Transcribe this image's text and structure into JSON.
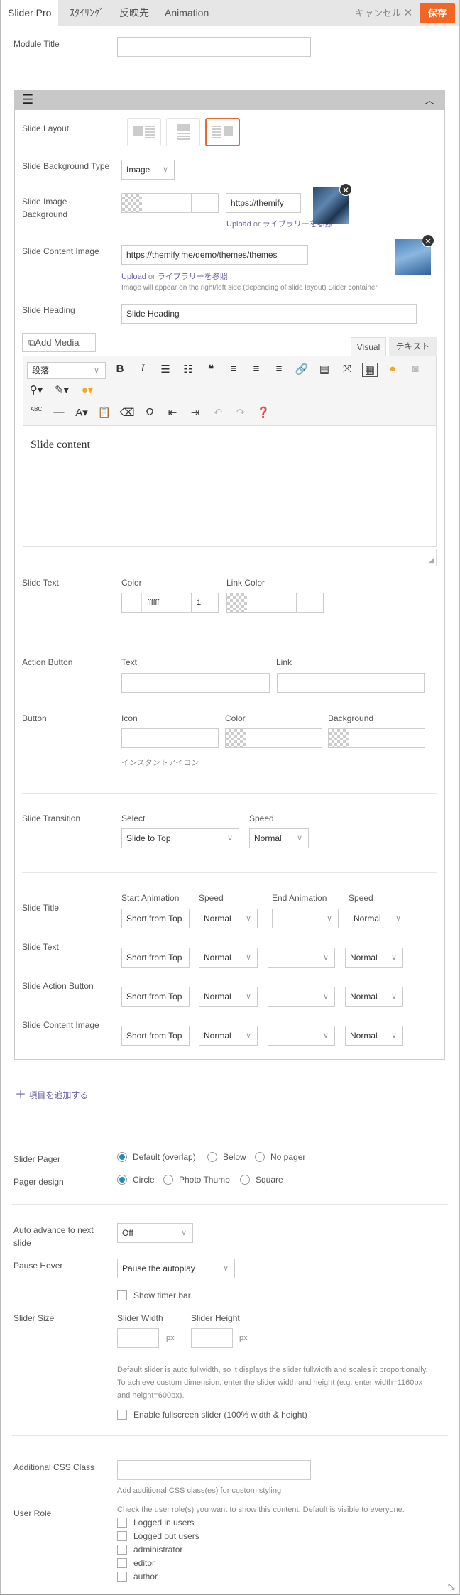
{
  "tabs": [
    "Slider Pro",
    "ｽﾀｲﾘﾝｸﾞ",
    "反映先",
    "Animation"
  ],
  "header": {
    "cancel": "キャンセル",
    "save": "保存"
  },
  "module_title": {
    "label": "Module Title",
    "value": ""
  },
  "slide": {
    "layout_label": "Slide Layout",
    "layout_selected": 3,
    "bg_type_label": "Slide Background Type",
    "bg_type": "Image",
    "bg_image_label": "Slide Image Background",
    "bg_image_url": "https://themify",
    "upload": "Upload",
    "or": "or",
    "library": "ライブラリーを参照",
    "content_image_label": "Slide Content Image",
    "content_image_url": "https://themify.me/demo/themes/themes",
    "content_image_help": "Image will appear on the right/left side (depending of slide layout) Slider container",
    "heading_label": "Slide Heading",
    "heading_value": "Slide Heading",
    "add_media": "Add Media",
    "tab_visual": "Visual",
    "tab_text": "テキスト",
    "format": "段落",
    "content": "Slide content",
    "text_label": "Slide Text",
    "color_label": "Color",
    "color_value": "ffffff",
    "opacity": "1",
    "link_color_label": "Link Color",
    "action_label": "Action Button",
    "text_field_label": "Text",
    "link_label": "Link",
    "button_label": "Button",
    "icon_label": "Icon",
    "bg_label": "Background",
    "instant_icon": "インスタントアイコン",
    "transition_label": "Slide Transition",
    "select_label": "Select",
    "transition": "Slide to Top",
    "speed_label": "Speed",
    "transition_speed": "Normal",
    "anim_headers": [
      "Start Animation",
      "Speed",
      "End Animation",
      "Speed"
    ],
    "anim_rows": [
      {
        "label": "Slide Title",
        "start": "Short from Top",
        "speed": "Normal",
        "end": "",
        "end_speed": "Normal"
      },
      {
        "label": "Slide Text",
        "start": "Short from Top",
        "speed": "Normal",
        "end": "",
        "end_speed": "Normal"
      },
      {
        "label": "Slide Action Button",
        "start": "Short from Top",
        "speed": "Normal",
        "end": "",
        "end_speed": "Normal"
      },
      {
        "label": "Slide Content Image",
        "start": "Short from Top",
        "speed": "Normal",
        "end": "",
        "end_speed": "Normal"
      }
    ]
  },
  "add_item": "項目を追加する",
  "pager": {
    "label": "Slider Pager",
    "options": [
      "Default (overlap)",
      "Below",
      "No pager"
    ],
    "selected": 0
  },
  "pager_design": {
    "label": "Pager design",
    "options": [
      "Circle",
      "Photo Thumb",
      "Square"
    ],
    "selected": 0
  },
  "auto": {
    "label": "Auto advance to next slide",
    "value": "Off"
  },
  "pause": {
    "label": "Pause Hover",
    "value": "Pause the autoplay",
    "timer": "Show timer bar"
  },
  "size": {
    "label": "Slider Size",
    "width_label": "Slider Width",
    "height_label": "Slider Height",
    "unit": "px",
    "help": "Default slider is auto fullwidth, so it displays the slider fullwidth and scales it proportionally. To achieve custom dimension, enter the slider width and height (e.g. enter width=1160px and height=600px).",
    "fullscreen": "Enable fullscreen slider (100% width & height)"
  },
  "css": {
    "label": "Additional CSS Class",
    "help": "Add additional CSS class(es) for custom styling"
  },
  "roles": {
    "label": "User Role",
    "help": "Check the user role(s) you want to show this content. Default is visible to everyone.",
    "options": [
      "Logged in users",
      "Logged out users",
      "administrator",
      "editor",
      "author"
    ]
  },
  "colors": {
    "accent": "#f26522",
    "radio": "#1e8cbe",
    "link": "#6b5fa5"
  }
}
